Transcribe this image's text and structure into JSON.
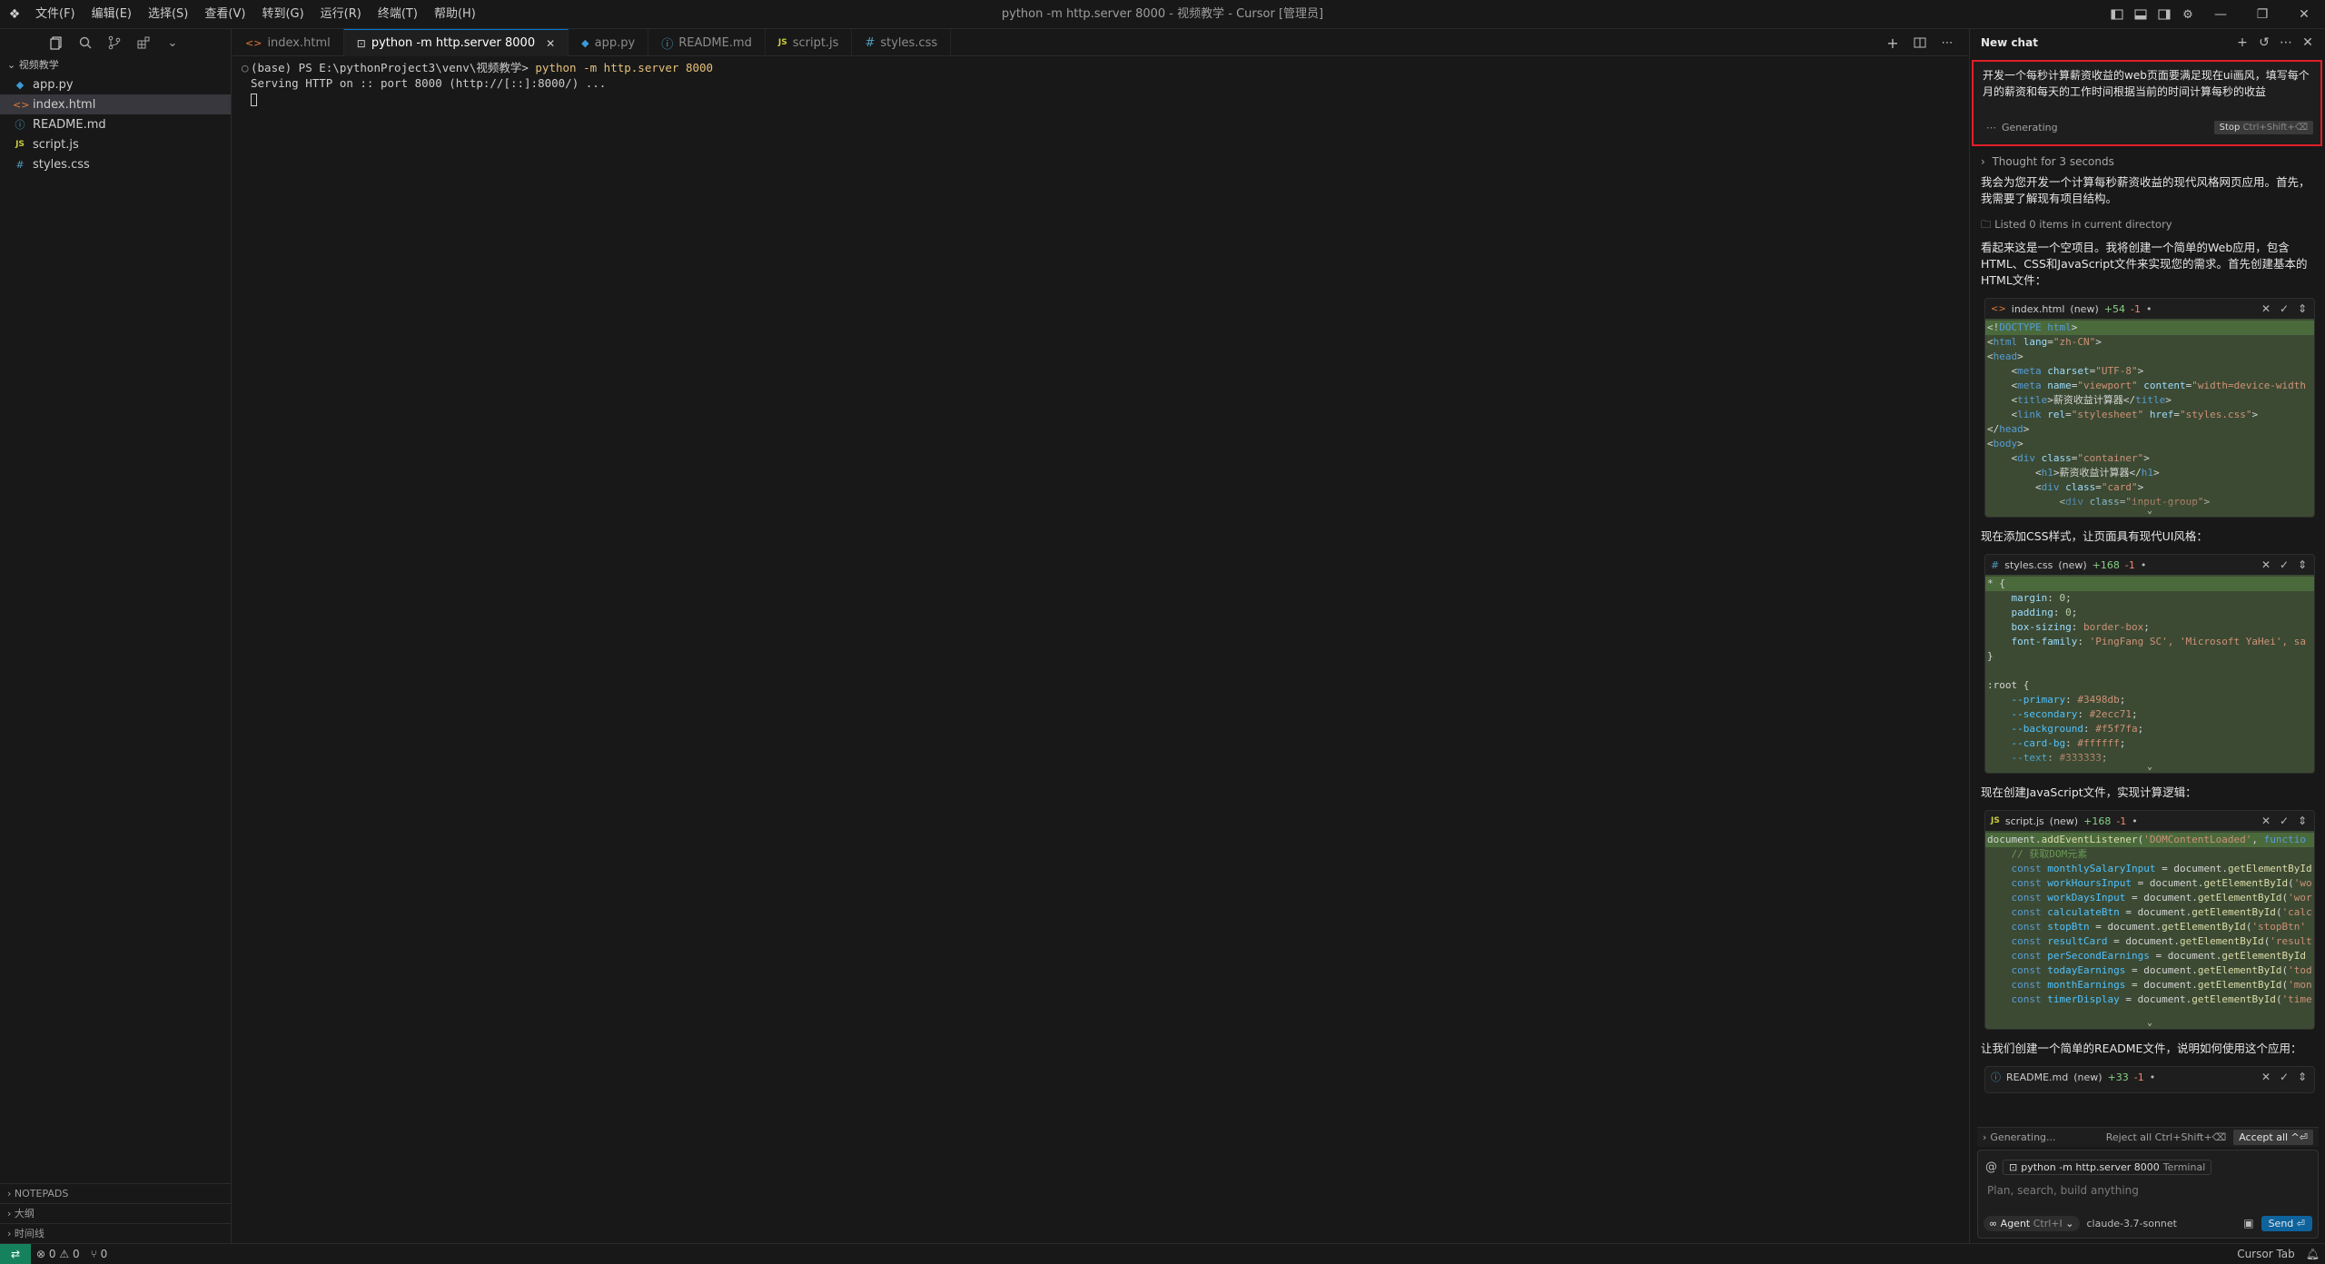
{
  "titlebar": {
    "window_title": "python -m http.server 8000 - 视频教学 - Cursor [管理员]",
    "menu": [
      "文件(F)",
      "编辑(E)",
      "选择(S)",
      "查看(V)",
      "转到(G)",
      "运行(R)",
      "终端(T)",
      "帮助(H)"
    ]
  },
  "sidebar": {
    "root_folder": "视频教学",
    "files": [
      {
        "name": "app.py",
        "type": "py"
      },
      {
        "name": "index.html",
        "type": "html",
        "selected": true
      },
      {
        "name": "README.md",
        "type": "md"
      },
      {
        "name": "script.js",
        "type": "js"
      },
      {
        "name": "styles.css",
        "type": "css"
      }
    ],
    "bottom_sections": [
      "NOTEPADS",
      "大纲",
      "时间线"
    ]
  },
  "tabs": [
    {
      "label": "index.html",
      "type": "html"
    },
    {
      "label": "python -m http.server 8000",
      "type": "terminal",
      "active": true
    },
    {
      "label": "app.py",
      "type": "py"
    },
    {
      "label": "README.md",
      "type": "md"
    },
    {
      "label": "script.js",
      "type": "js"
    },
    {
      "label": "styles.css",
      "type": "css"
    }
  ],
  "terminal": {
    "prompt": "(base) PS E:\\pythonProject3\\venv\\视频教学> ",
    "command": "python -m http.server 8000",
    "output": "Serving HTTP on :: port 8000 (http://[::]:8000/) ..."
  },
  "chat": {
    "title": "New chat",
    "user_message": "开发一个每秒计算薪资收益的web页面要满足现在ui画风，填写每个月的薪资和每天的工作时间根据当前的时间计算每秒的收益",
    "generating_label": "Generating",
    "stop_label": "Stop",
    "stop_shortcut": "Ctrl+Shift+⌫",
    "thought": "Thought for 3 seconds",
    "para1": "我会为您开发一个计算每秒薪资收益的现代风格网页应用。首先，我需要了解现有项目结构。",
    "listed_note": "Listed 0 items in current directory",
    "para2": "看起来这是一个空项目。我将创建一个简单的Web应用，包含HTML、CSS和JavaScript文件来实现您的需求。首先创建基本的HTML文件：",
    "para3": "现在添加CSS样式，让页面具有现代UI风格：",
    "para4": "现在创建JavaScript文件，实现计算逻辑：",
    "para5": "让我们创建一个简单的README文件，说明如何使用这个应用：",
    "cards": {
      "html": {
        "file": "index.html",
        "tag": "(new)",
        "add": "+54",
        "del": "-1"
      },
      "css": {
        "file": "styles.css",
        "tag": "(new)",
        "add": "+168",
        "del": "-1"
      },
      "js": {
        "file": "script.js",
        "tag": "(new)",
        "add": "+168",
        "del": "-1"
      },
      "md": {
        "file": "README.md",
        "tag": "(new)",
        "add": "+33",
        "del": "-1"
      }
    },
    "gen_bar": {
      "label": "Generating...",
      "reject": "Reject all Ctrl+Shift+⌫",
      "accept": "Accept all ^⏎"
    },
    "composer": {
      "context_label": "python -m http.server 8000",
      "context_kind": "Terminal",
      "placeholder": "Plan, search, build anything",
      "mode": "Agent",
      "mode_shortcut": "Ctrl+I",
      "model": "claude-3.7-sonnet",
      "send": "Send ⏎"
    }
  },
  "statusbar": {
    "errors": "0",
    "warnings": "0",
    "ports": "0",
    "right_label": "Cursor Tab"
  }
}
